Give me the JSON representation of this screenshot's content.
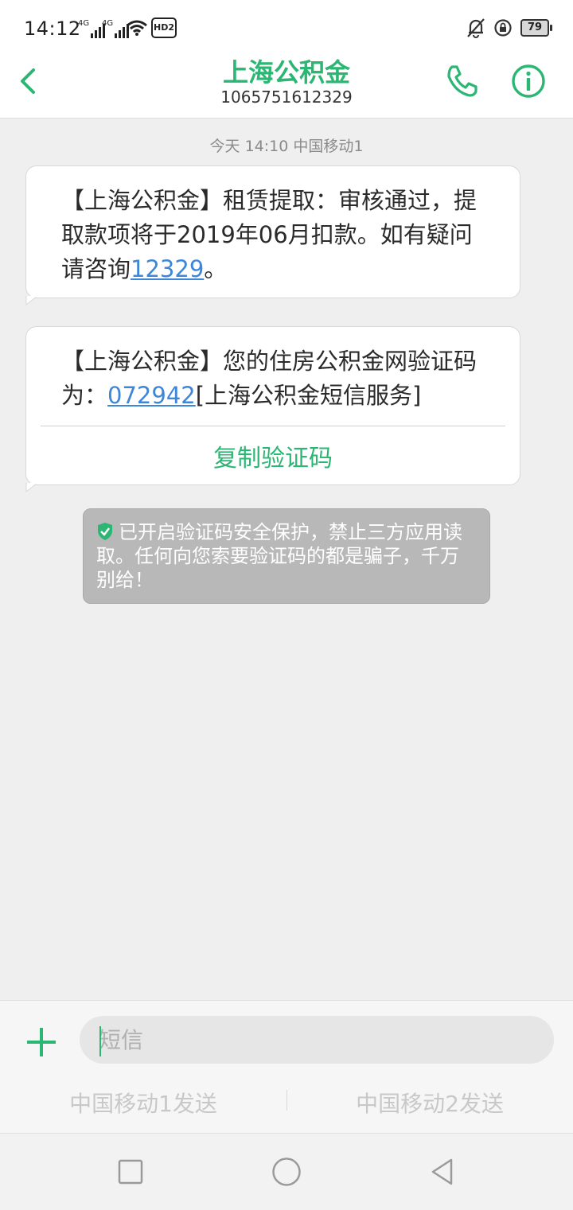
{
  "status_bar": {
    "time": "14:12",
    "network_1": "4G",
    "network_2": "4G",
    "hd_label": "HD2",
    "battery": "79"
  },
  "header": {
    "contact_name": "上海公积金",
    "contact_number": "1065751612329",
    "icons": [
      "back-icon",
      "phone-icon",
      "info-icon"
    ],
    "accent_color": "#2bb673"
  },
  "conversation": {
    "timestamp": "今天 14:10  中国移动1",
    "messages": [
      {
        "text_before": "【上海公积金】租赁提取：审核通过，提取款项将于2019年06月扣款。如有疑问请咨询",
        "link": "12329",
        "text_after": "。"
      },
      {
        "text_before": "【上海公积金】您的住房公积金网验证码为：",
        "link": "072942",
        "text_after": "[上海公积金短信服务]",
        "action": "复制验证码"
      }
    ],
    "security_notice": "已开启验证码安全保护，禁止三方应用读取。任何向您索要验证码的都是骗子，千万别给！"
  },
  "compose": {
    "placeholder": "短信",
    "send_sim1": "中国移动1发送",
    "send_sim2": "中国移动2发送"
  },
  "nav": {
    "icons": [
      "recents-icon",
      "home-icon",
      "back-triangle-icon"
    ]
  }
}
